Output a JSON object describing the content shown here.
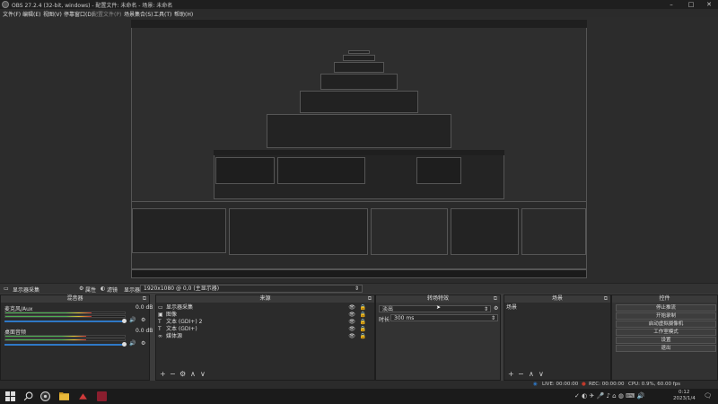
{
  "window": {
    "title": "OBS 27.2.4 (32-bit, windows) - 配置文件: 未命名 - 场景: 未命名",
    "minimize": "–",
    "maximize": "□",
    "close": "✕"
  },
  "menu": {
    "items": [
      "文件(F)",
      "编辑(E)",
      "视图(V)",
      "停靠窗口(D)",
      "配置文件(P)",
      "场景集合(S)",
      "工具(T)",
      "帮助(H)"
    ]
  },
  "scene_toolbar": {
    "scene_name": "显示器采集",
    "properties": "属性",
    "filters": "滤镜",
    "display_label": "显示器：",
    "display_value": "1920x1080 @ 0,0 (主显示器)"
  },
  "docks": {
    "mixer": {
      "title": "混音器",
      "channels": [
        {
          "name": "麦克风/Aux",
          "db": "0.0 dB",
          "level": 0.72
        },
        {
          "name": "桌面音频",
          "db": "0.0 dB",
          "level": 0.68
        }
      ]
    },
    "sources": {
      "title": "来源",
      "items": [
        {
          "icon": "monitor-icon",
          "glyph": "▭",
          "label": "显示器采集"
        },
        {
          "icon": "image-icon",
          "glyph": "▣",
          "label": "图像"
        },
        {
          "icon": "text-icon",
          "glyph": "T",
          "label": "文本 (GDI+) 2"
        },
        {
          "icon": "text-icon",
          "glyph": "T",
          "label": "文本 (GDI+)"
        },
        {
          "icon": "media-icon",
          "glyph": "∞",
          "label": "媒体源"
        }
      ]
    },
    "transitions": {
      "title": "转场特效",
      "type_value": "淡出",
      "duration_label": "时长",
      "duration_value": "300 ms"
    },
    "scenes": {
      "title": "场景",
      "items": [
        "场景"
      ]
    },
    "controls": {
      "title": "控件",
      "buttons": [
        "停止推流",
        "开始录制",
        "启动虚拟摄像机",
        "工作室模式",
        "设置",
        "退出"
      ]
    }
  },
  "statusbar": {
    "live": "LIVE: 00:00:00",
    "rec": "REC: 00:00:00",
    "cpu": "CPU: 0.9%, 60.00 fps"
  },
  "taskbar": {
    "time": "0:12",
    "date": "2023/1/4"
  },
  "colors": {
    "accent": "#2f78c6",
    "meter_green": "#4caf50",
    "meter_yellow": "#e0c030",
    "meter_red": "#c03030",
    "record_red": "#c0392b"
  }
}
